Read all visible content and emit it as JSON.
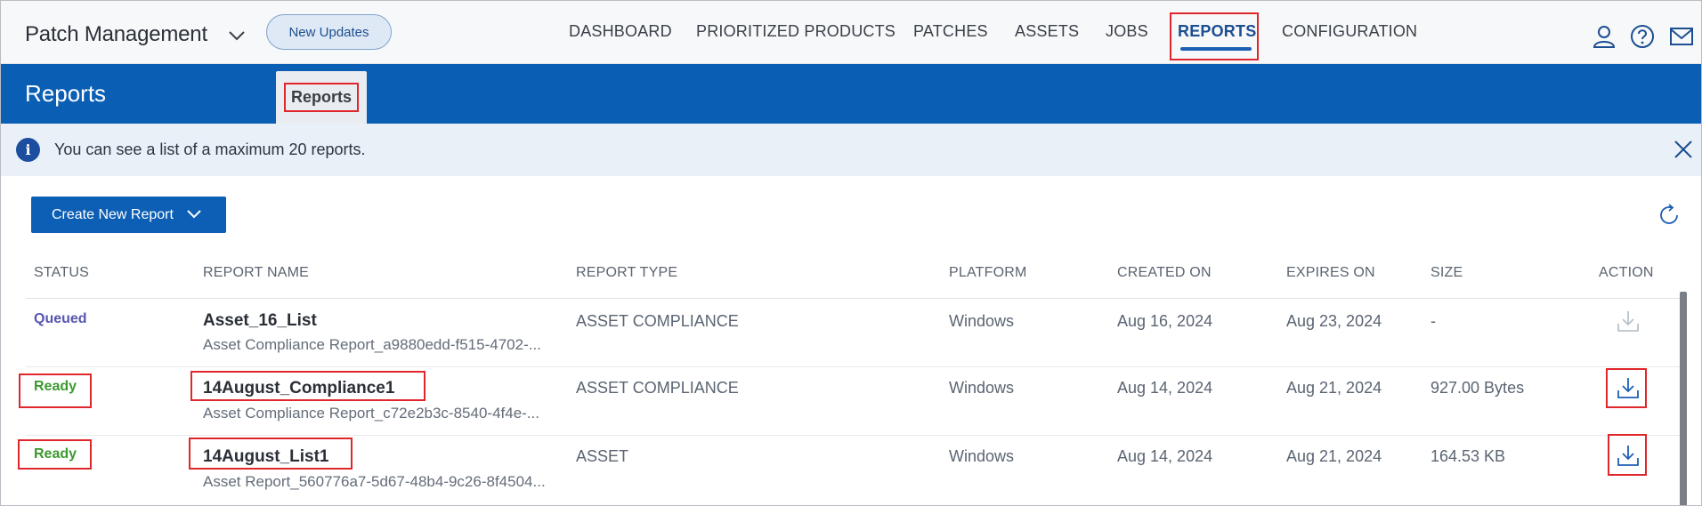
{
  "app": {
    "title": "Patch Management",
    "new_updates_label": "New Updates"
  },
  "nav": {
    "items": [
      "DASHBOARD",
      "PRIORITIZED PRODUCTS",
      "PATCHES",
      "ASSETS",
      "JOBS",
      "REPORTS",
      "CONFIGURATION"
    ],
    "active": "REPORTS"
  },
  "header": {
    "page_title": "Reports",
    "sub_tab": "Reports"
  },
  "banner": {
    "text": "You can see a list of a maximum 20 reports."
  },
  "toolbar": {
    "create_label": "Create New Report"
  },
  "table": {
    "columns": [
      "STATUS",
      "REPORT NAME",
      "REPORT TYPE",
      "PLATFORM",
      "CREATED ON",
      "EXPIRES ON",
      "SIZE",
      "ACTION"
    ],
    "rows": [
      {
        "status": "Queued",
        "name": "Asset_16_List",
        "subname": "Asset Compliance Report_a9880edd-f515-4702-...",
        "type": "ASSET COMPLIANCE",
        "platform": "Windows",
        "created": "Aug 16, 2024",
        "expires": "Aug 23, 2024",
        "size": "-"
      },
      {
        "status": "Ready",
        "name": "14August_Compliance1",
        "subname": "Asset Compliance Report_c72e2b3c-8540-4f4e-...",
        "type": "ASSET COMPLIANCE",
        "platform": "Windows",
        "created": "Aug 14, 2024",
        "expires": "Aug 21, 2024",
        "size": "927.00 Bytes"
      },
      {
        "status": "Ready",
        "name": "14August_List1",
        "subname": "Asset Report_560776a7-5d67-48b4-9c26-8f4504...",
        "type": "ASSET",
        "platform": "Windows",
        "created": "Aug 14, 2024",
        "expires": "Aug 21, 2024",
        "size": "164.53 KB"
      }
    ]
  },
  "colors": {
    "brand_blue": "#0a5fb4",
    "highlight_red": "#e0262b",
    "ready_green": "#3a9a2e",
    "queued_purple": "#5756b0"
  },
  "icons": {
    "app_switch": "chevron-down-icon",
    "user": "user-icon",
    "help": "help-icon",
    "mail": "mail-icon",
    "info": "info-icon",
    "close": "close-icon",
    "refresh": "refresh-icon",
    "download": "download-icon"
  }
}
